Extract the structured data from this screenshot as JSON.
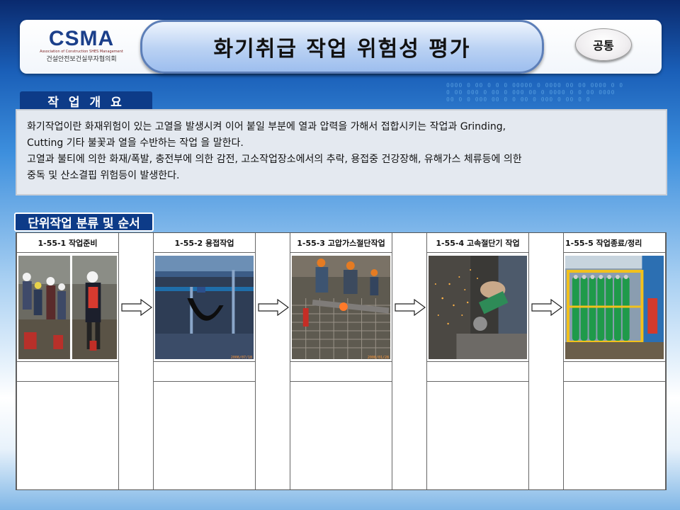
{
  "header": {
    "logo_text": "CSMA",
    "logo_subtitle": "Association of Construction SHES Management",
    "logo_korean": "건설안전보건실무자협의회",
    "title": "화기취급 작업 위험성 평가",
    "badge": "공통"
  },
  "overview": {
    "tab_label": "작업개요",
    "line1": "화기작업이란 화재위험이 있는 고열을 발생시켜 이어 붙일 부분에 열과 압력을 가해서 접합시키는 작업과 Grinding,",
    "line2": "Cutting 기타 불꽃과 열을 수반하는 작업 을 말한다.",
    "line3": "고열과 불티에 의한 화재/폭발, 충전부에 의한 감전, 고소작업장소에서의 추락, 용접중 건강장해, 유해가스 체류등에 의한",
    "line4": "중독 및 산소결핍 위험등이 발생한다."
  },
  "steps_section": {
    "tab_label": "단위작업 분류 및 순서",
    "steps": [
      {
        "label": "1-55-1 작업준비",
        "date": ""
      },
      {
        "label": "1-55-2 용접작업",
        "date": "2008/07/18"
      },
      {
        "label": "1-55-3 고압가스절단작업",
        "date": "2008/01/28"
      },
      {
        "label": "1-55-4 고속절단기 작업",
        "date": ""
      },
      {
        "label": "1-55-5  작업종료/정리",
        "date": ""
      }
    ]
  },
  "colors": {
    "accent_navy": "#0d3b88",
    "title_pill": "#b9d1f3"
  },
  "icons": [
    "right-arrow-icon"
  ]
}
